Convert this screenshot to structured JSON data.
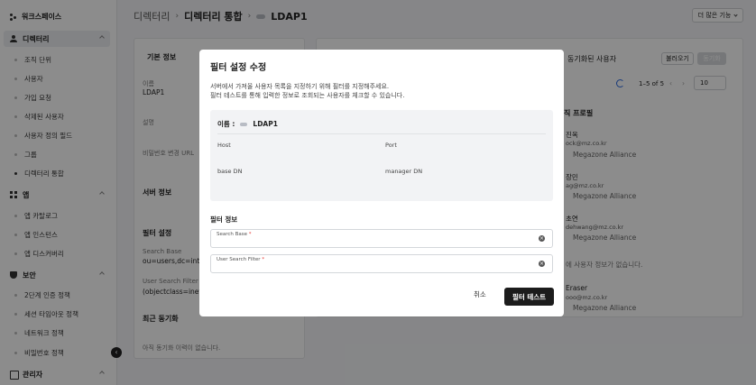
{
  "sidebar": {
    "workspace": "워크스페이스",
    "sections": [
      {
        "label": "디렉터리"
      },
      {
        "label": "앱"
      },
      {
        "label": "보안"
      },
      {
        "label": "관리자"
      }
    ],
    "directory_items": [
      "조직 단위",
      "사용자",
      "가입 요청",
      "삭제된 사용자",
      "사용자 정의 필드",
      "그룹",
      "디렉터리 통합"
    ],
    "app_items": [
      "앱 카탈로그",
      "앱 인스턴스",
      "앱 디스커버리"
    ],
    "security_items": [
      "2단계 인증 정책",
      "세션 타임아웃 정책",
      "네트워크 정책",
      "비밀번호 정책"
    ],
    "collapse_icon": "‹"
  },
  "breadcrumb": {
    "items": [
      "디렉터리",
      "디렉터리 통합",
      "LDAP1"
    ],
    "sep": "›"
  },
  "header": {
    "more_label": "더 많은 기능"
  },
  "basic": {
    "title": "기본 정보",
    "name_label": "이름",
    "name_value": "LDAP1",
    "desc_label": "설명",
    "pw_label": "비밀번호 변경 URL",
    "server_title": "서버 정보",
    "filter_title": "필터 설정",
    "search_base_label": "Search Base",
    "search_base_value": "ou=users,dc=integr",
    "user_filter_label": "User Search Filter",
    "user_filter_value": "(objectclass=inetOr",
    "recent_sync_title": "최근 동기화",
    "recent_sync_empty": "아직 동기화 이력이 없습니다."
  },
  "synced": {
    "title": "동기화된 사용자",
    "load_label": "불러오기",
    "sync_label": "동기화",
    "pagination": "1–5 of 5",
    "page_size": "10",
    "col_profile": "직 프로필",
    "rows": [
      {
        "name": "진옥",
        "email": "ock@mz.co.kr",
        "org": "Megazone Alliance"
      },
      {
        "name": "장민",
        "email": "ag@mz.co.kr",
        "org": "Megazone Alliance"
      },
      {
        "name": "초연",
        "email": "dehwang@mz.co.kr",
        "org": "Megazone Alliance"
      },
      {
        "name": "",
        "email": "",
        "org": "",
        "note": "에 사용자 정보가 없습니다."
      },
      {
        "name": "Eraser",
        "email": "ooo@mz.co.kr",
        "org": "Megazone Alliance"
      }
    ]
  },
  "modal": {
    "title": "필터 설정 수정",
    "desc1": "서버에서 가져올 사용자 목록을 지정하기 위해 필터를 지정해주세요.",
    "desc2": "필터 테스트를 통해 입력한 정보로 조회되는 사용자를 체크할 수 있습니다.",
    "info_name_label": "이름 :",
    "info_name_value": "LDAP1",
    "host_label": "Host",
    "port_label": "Port",
    "basedn_label": "base DN",
    "managerdn_label": "manager DN",
    "filter_info_title": "필터 정보",
    "search_base_label": "Search Base",
    "search_base_value": "",
    "user_filter_label": "User Search Filter",
    "user_filter_value": "",
    "required_mark": "*",
    "cancel_label": "취소",
    "test_label": "필터 테스트"
  }
}
